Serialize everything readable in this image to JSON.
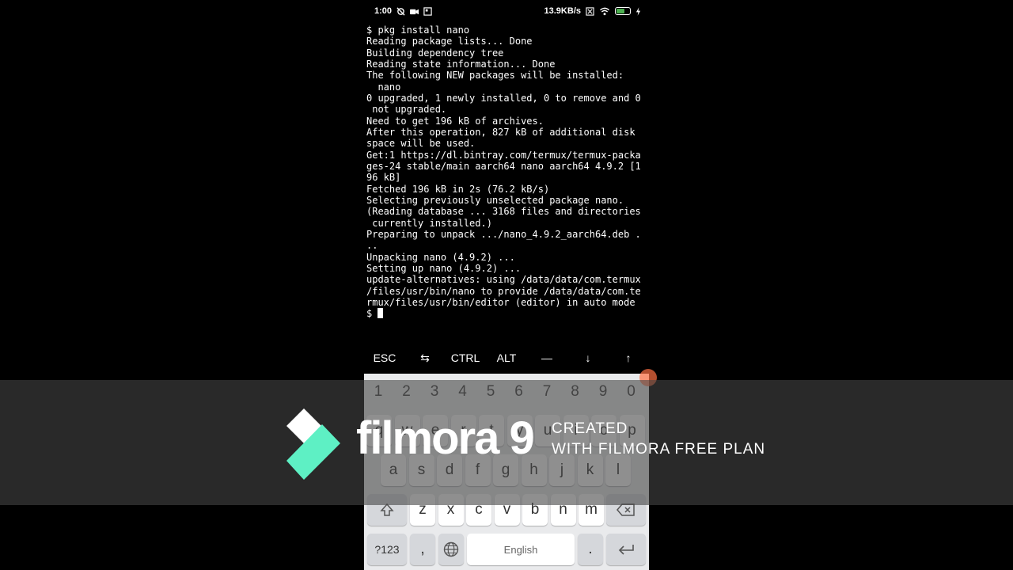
{
  "status_bar": {
    "time": "1:00",
    "network_speed": "13.9KB/s",
    "battery_level": "60",
    "icons": [
      "wifi-call-icon",
      "video-icon",
      "image-icon",
      "sim-icon",
      "wifi-icon",
      "battery-icon",
      "charging-icon"
    ]
  },
  "terminal": {
    "lines": [
      "$ pkg install nano",
      "Reading package lists... Done",
      "Building dependency tree",
      "Reading state information... Done",
      "The following NEW packages will be installed:",
      "  nano",
      "0 upgraded, 1 newly installed, 0 to remove and 0",
      " not upgraded.",
      "Need to get 196 kB of archives.",
      "After this operation, 827 kB of additional disk",
      "space will be used.",
      "Get:1 https://dl.bintray.com/termux/termux-packa",
      "ges-24 stable/main aarch64 nano aarch64 4.9.2 [1",
      "96 kB]",
      "Fetched 196 kB in 2s (76.2 kB/s)",
      "Selecting previously unselected package nano.",
      "(Reading database ... 3168 files and directories",
      " currently installed.)",
      "Preparing to unpack .../nano_4.9.2_aarch64.deb .",
      "..",
      "Unpacking nano (4.9.2) ...",
      "Setting up nano (4.9.2) ...",
      "update-alternatives: using /data/data/com.termux",
      "/files/usr/bin/nano to provide /data/data/com.te",
      "rmux/files/usr/bin/editor (editor) in auto mode"
    ],
    "prompt": "$ "
  },
  "extra_keys": {
    "esc": "ESC",
    "tab": "⇆",
    "ctrl": "CTRL",
    "alt": "ALT",
    "dash": "—",
    "down": "↓",
    "up": "↑"
  },
  "keyboard": {
    "numbers": [
      "1",
      "2",
      "3",
      "4",
      "5",
      "6",
      "7",
      "8",
      "9",
      "0"
    ],
    "row1": [
      "q",
      "w",
      "e",
      "r",
      "t",
      "y",
      "u",
      "i",
      "o",
      "p"
    ],
    "row2": [
      "a",
      "s",
      "d",
      "f",
      "g",
      "h",
      "j",
      "k",
      "l"
    ],
    "row3": [
      "z",
      "x",
      "c",
      "v",
      "b",
      "n",
      "m"
    ],
    "symbols_label": "?123",
    "comma": ",",
    "space_label": "English",
    "period": "."
  },
  "watermark": {
    "brand": "filmora 9",
    "line1": "CREATED",
    "line2": "WITH FILMORA FREE PLAN",
    "logo_colors": [
      "#ffffff",
      "#5ef0c4"
    ]
  }
}
